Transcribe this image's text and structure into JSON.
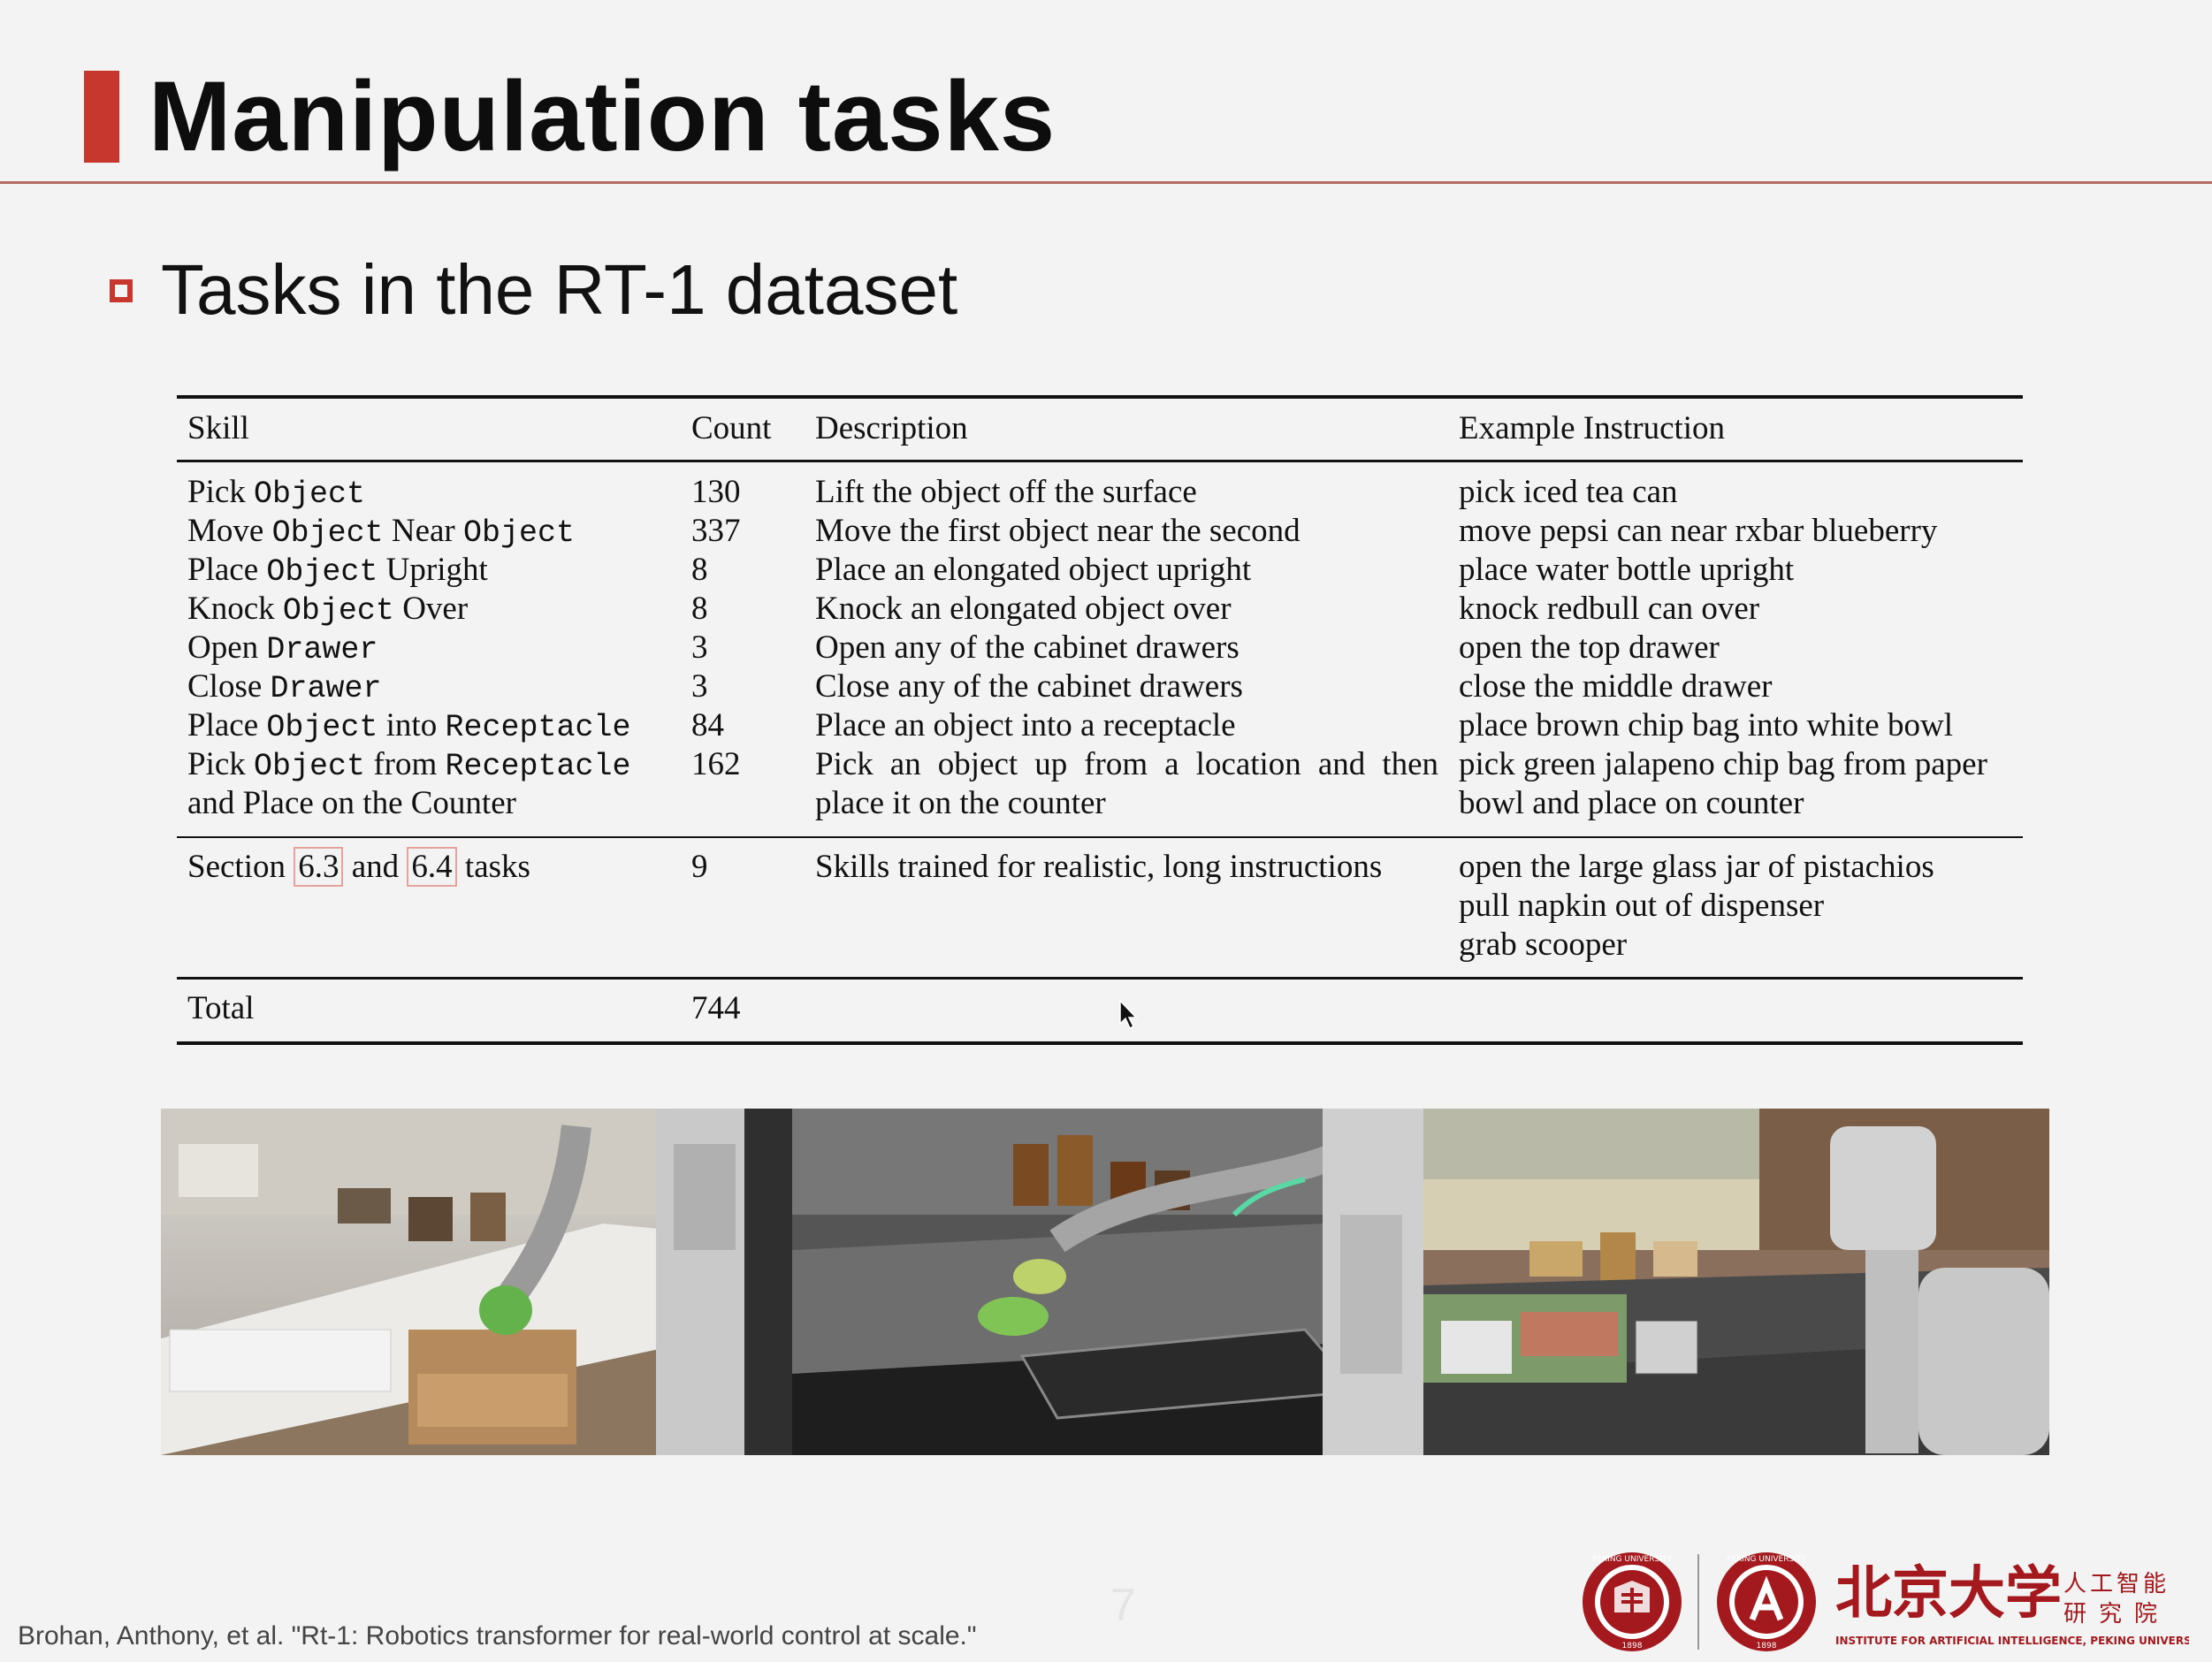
{
  "slide": {
    "title": "Manipulation tasks",
    "subtitle": "Tasks in the RT-1 dataset",
    "citation": "Brohan, Anthony, et al. \"Rt-1: Robotics transformer for real-world control at scale.\"",
    "page_number": "7"
  },
  "table": {
    "headers": {
      "skill": "Skill",
      "count": "Count",
      "description": "Description",
      "example": "Example Instruction"
    },
    "rows": [
      {
        "skill": [
          "Pick",
          "Object"
        ],
        "count": "130",
        "description": "Lift the object off the surface",
        "example": "pick iced tea can"
      },
      {
        "skill": [
          "Move",
          "Object",
          "Near",
          "Object"
        ],
        "count": "337",
        "description": "Move the first object near the second",
        "example": "move pepsi can near rxbar blueberry"
      },
      {
        "skill": [
          "Place",
          "Object",
          "Upright"
        ],
        "count": "8",
        "description": "Place an elongated object upright",
        "example": "place water bottle upright"
      },
      {
        "skill": [
          "Knock",
          "Object",
          "Over"
        ],
        "count": "8",
        "description": "Knock an elongated object over",
        "example": "knock redbull can over"
      },
      {
        "skill": [
          "Open",
          "Drawer"
        ],
        "count": "3",
        "description": "Open any of the cabinet drawers",
        "example": "open the top drawer"
      },
      {
        "skill": [
          "Close",
          "Drawer"
        ],
        "count": "3",
        "description": "Close any of the cabinet drawers",
        "example": "close the middle drawer"
      },
      {
        "skill": [
          "Place",
          "Object",
          "into",
          "Receptacle"
        ],
        "count": "84",
        "description": "Place an object into a receptacle",
        "example": "place brown chip bag into white bowl"
      },
      {
        "skill": [
          "Pick",
          "Object",
          "from",
          "Receptacle"
        ],
        "skill_line2": "and Place on the Counter",
        "count": "162",
        "description": "Pick an object up from a location and then",
        "description_line2": "place it on the counter",
        "example": "pick green jalapeno chip bag from paper",
        "example_line2": "bowl and place on counter"
      }
    ],
    "section_row": {
      "skill_prefix": "Section",
      "ref1": "6.3",
      "and": "and",
      "ref2": "6.4",
      "suffix": "tasks",
      "count": "9",
      "description": "Skills trained for realistic, long instructions",
      "examples": [
        "open the large glass jar of pistachios",
        "pull napkin out of dispenser",
        "grab scooper"
      ]
    },
    "total": {
      "label": "Total",
      "count": "744"
    }
  },
  "logos": {
    "institute_cn_large": "北京大学",
    "institute_cn_small_1": "人工智能",
    "institute_cn_small_2": "研究院",
    "institute_en": "INSTITUTE FOR ARTIFICIAL INTELLIGENCE, PEKING UNIVERSITY",
    "seal_text": "PEKING UNIVERSITY",
    "seal_year": "1898"
  },
  "colors": {
    "accent": "#c8372d",
    "rule": "#b56a64"
  }
}
